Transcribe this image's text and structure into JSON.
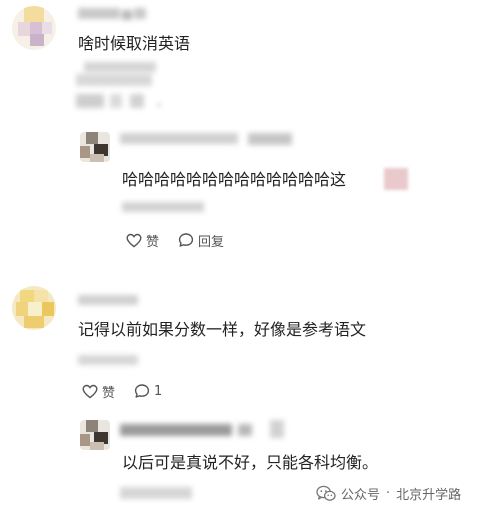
{
  "comments": [
    {
      "text": "啥时候取消英语",
      "reply": {
        "text": "哈哈哈哈哈哈哈哈哈哈哈哈哈这",
        "like_label": "赞",
        "reply_label": "回复"
      }
    },
    {
      "text": "记得以前如果分数一样，好像是参考语文",
      "like_label": "赞",
      "reply_count": "1",
      "reply": {
        "text": "以后可是真说不好，只能各科均衡。"
      }
    }
  ],
  "watermark": {
    "platform": "公众号",
    "separator": "·",
    "account": "北京升学路"
  },
  "colors": {
    "text": "#222222",
    "action": "#555555",
    "watermark": "#666666"
  }
}
